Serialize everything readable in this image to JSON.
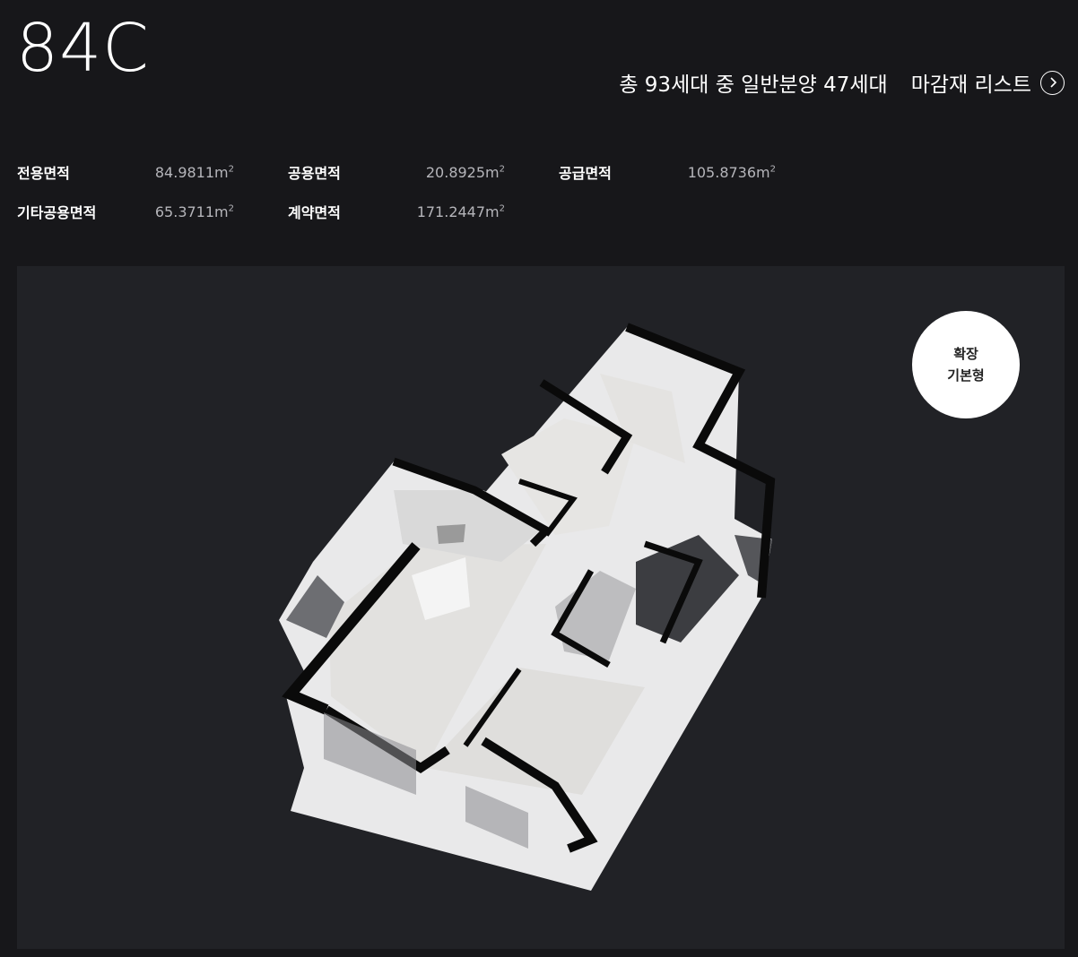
{
  "header": {
    "type_name": "84C",
    "household_info": "총 93세대 중 일반분양 47세대",
    "finish_list_label": "마감재 리스트",
    "finish_list_icon": "chevron-right-icon"
  },
  "areas": [
    {
      "label": "전용면적",
      "value": "84.9811m"
    },
    {
      "label": "공용면적",
      "value": "20.8925m"
    },
    {
      "label": "공급면적",
      "value": "105.8736m"
    },
    {
      "label": "기타공용면적",
      "value": "65.3711m"
    },
    {
      "label": "계약면적",
      "value": "171.2447m"
    }
  ],
  "area_unit_exponent": "2",
  "plan": {
    "badge_line1": "확장",
    "badge_line2": "기본형"
  }
}
